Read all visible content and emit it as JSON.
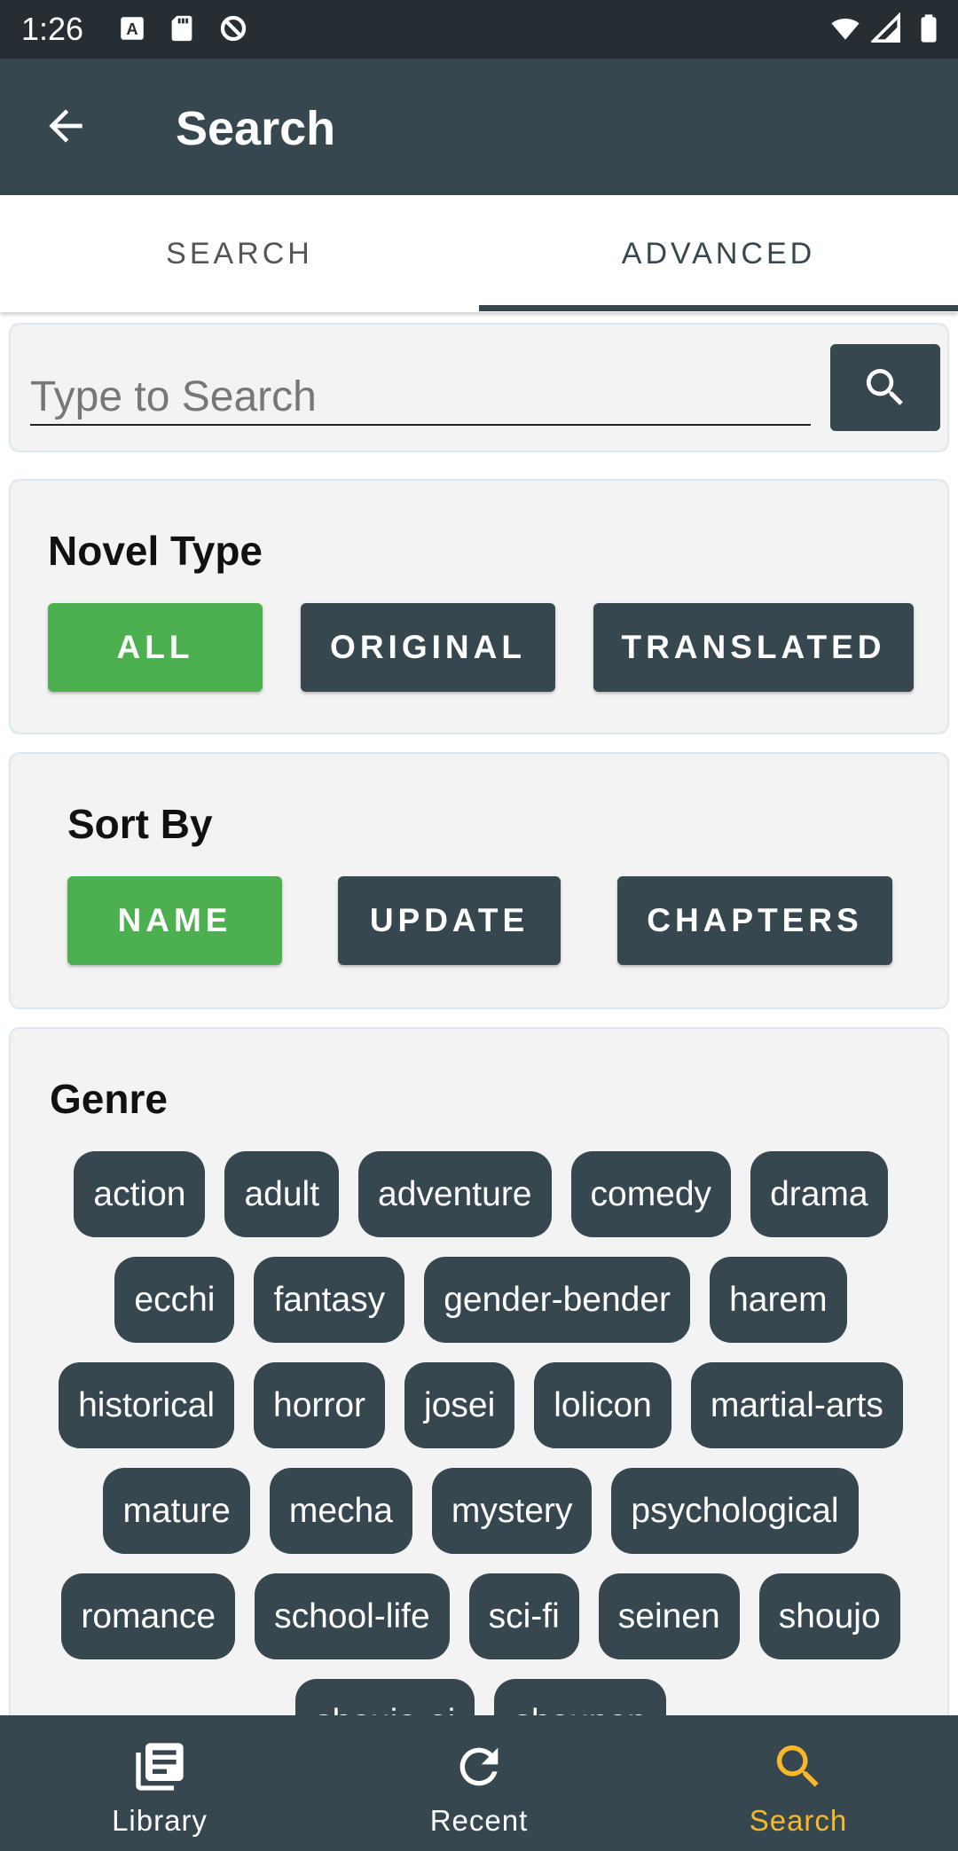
{
  "status_bar": {
    "time": "1:26"
  },
  "app_bar": {
    "title": "Search"
  },
  "tabs": [
    {
      "label": "SEARCH",
      "active": false
    },
    {
      "label": "ADVANCED",
      "active": true
    }
  ],
  "search": {
    "placeholder": "Type to Search",
    "value": ""
  },
  "novel_type": {
    "title": "Novel Type",
    "options": [
      "ALL",
      "ORIGINAL",
      "TRANSLATED"
    ],
    "selected": "ALL"
  },
  "sort_by": {
    "title": "Sort By",
    "options": [
      "NAME",
      "UPDATE",
      "CHAPTERS"
    ],
    "selected": "NAME"
  },
  "genre": {
    "title": "Genre",
    "items": [
      "action",
      "adult",
      "adventure",
      "comedy",
      "drama",
      "ecchi",
      "fantasy",
      "gender-bender",
      "harem",
      "historical",
      "horror",
      "josei",
      "lolicon",
      "martial-arts",
      "mature",
      "mecha",
      "mystery",
      "psychological",
      "romance",
      "school-life",
      "sci-fi",
      "seinen",
      "shoujo",
      "shoujo-ai",
      "shounen"
    ]
  },
  "bottom_nav": [
    {
      "label": "Library",
      "icon": "library-icon",
      "active": false
    },
    {
      "label": "Recent",
      "icon": "refresh-icon",
      "active": false
    },
    {
      "label": "Search",
      "icon": "search-icon",
      "active": true
    }
  ],
  "colors": {
    "primary": "#37474f",
    "status_bar": "#262e33",
    "selected_green": "#4cb050",
    "active_nav": "#f9b82a",
    "card_bg": "#f3f3f3"
  }
}
